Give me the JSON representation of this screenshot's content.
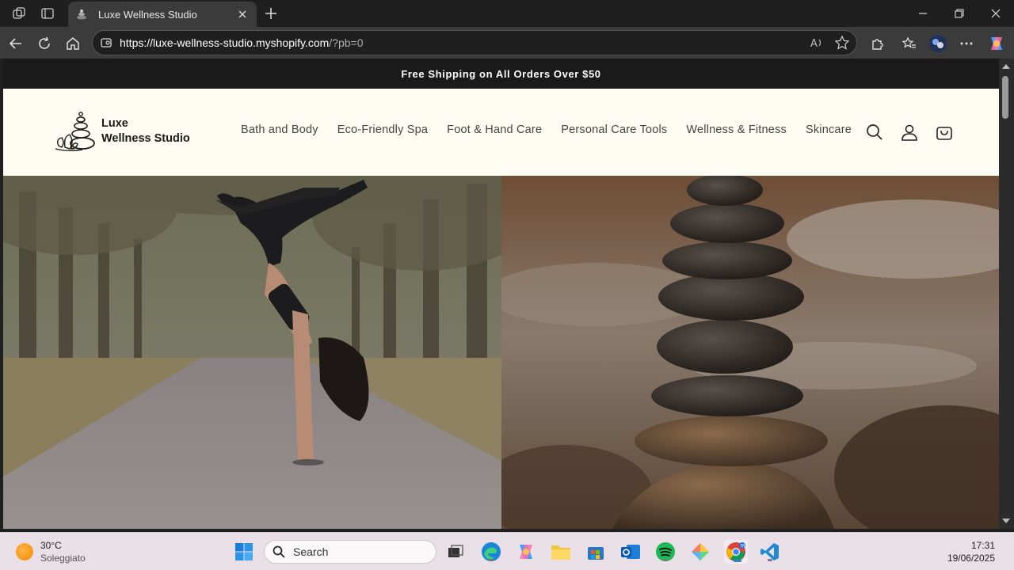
{
  "browser": {
    "tab_title": "Luxe Wellness Studio",
    "url_host": "https://luxe-wellness-studio.myshopify.com",
    "url_rest": "/?pb=0"
  },
  "store": {
    "announcement": "Free Shipping on All Orders Over $50",
    "logo_line1": "Luxe",
    "logo_line2": "Wellness Studio",
    "nav": [
      {
        "label": "Bath and Body"
      },
      {
        "label": "Eco-Friendly Spa"
      },
      {
        "label": "Foot & Hand Care"
      },
      {
        "label": "Personal Care Tools"
      },
      {
        "label": "Wellness & Fitness"
      },
      {
        "label": "Skincare"
      }
    ],
    "header_icons": [
      "search-icon",
      "account-icon",
      "cart-icon"
    ],
    "hero_images": [
      "yoga-handstand-image",
      "stacked-stones-image"
    ]
  },
  "taskbar": {
    "temperature": "30°C",
    "weather": "Soleggiato",
    "search_placeholder": "Search",
    "time": "17:31",
    "date": "19/06/2025",
    "apps": [
      "windows-start-icon",
      "search-icon",
      "task-view-icon",
      "edge-icon",
      "copilot-icon",
      "file-explorer-icon",
      "microsoft-store-icon",
      "outlook-icon",
      "spotify-icon",
      "tools-app-icon",
      "chrome-icon",
      "vscode-icon"
    ]
  },
  "colors": {
    "announcement_bg": "#1a1a1a",
    "header_bg": "#fdfdf4",
    "nav_text": "#444444"
  }
}
